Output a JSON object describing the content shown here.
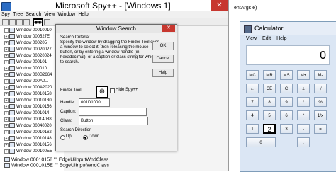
{
  "spy": {
    "title": "Microsoft Spy++ - [Windows 1]",
    "close_glyph": "✕",
    "menu": [
      "Spy",
      "Tree",
      "Search",
      "View",
      "Window",
      "Help"
    ],
    "find_icon": "binoculars-icon",
    "tree": {
      "rows": [
        "Window 00010010",
        "Window 000527E",
        "Window 000205",
        "Window 00020027",
        "Window 00020024",
        "Window 000101",
        "Window 000010",
        "Window 000B2664",
        "Window 000A0...",
        "Window 000A2020",
        "Window 00010158",
        "Window 00010130",
        "Window 00010156",
        "Window 0001014",
        "Window 00014088",
        "Window 00040020",
        "Window 00010162",
        "Window 00010148",
        "Window 00010156",
        "Window 000100EE",
        "Window 00010158",
        "Window 0001015E"
      ],
      "bottom_rows": [
        "\"\" EdgeUiInputWndClass",
        "\"\" EdgeUiInputWndClass"
      ]
    }
  },
  "dialog": {
    "title": "Window Search",
    "close_glyph": "✕",
    "criteria_label": "Search Criteria:",
    "description": "Specify the window by dragging the Finder Tool over a window to select it, then releasing the mouse button, or by entering a window handle (in hexadecimal), or a caption or class string for which to search.",
    "ok_label": "OK",
    "cancel_label": "Cancel",
    "help_label": "Help",
    "finder_label": "Finder Tool:",
    "finder_icon": "crosshair-target-icon",
    "hide_label": "Hide Spy++",
    "handle_label": "Handle:",
    "handle_value": "001D1000",
    "caption_label": "Caption:",
    "caption_value": "",
    "class_label": "Class:",
    "class_value": "Button",
    "direction_label": "Search Direction",
    "up_label": "Up",
    "down_label": "Down"
  },
  "calc": {
    "tab_text": "entArgs e)",
    "title": "Calculator",
    "menu": [
      "View",
      "Edit",
      "Help"
    ],
    "display": "0",
    "keys_top": [
      "MC",
      "MR",
      "MS",
      "M+",
      "M-"
    ],
    "keys_row2": [
      "←",
      "CE",
      "C",
      "±",
      "√"
    ],
    "keys_row3": [
      "7",
      "8",
      "9",
      "/",
      "%"
    ],
    "keys_row4": [
      "4",
      "5",
      "6",
      "*",
      "1/x"
    ],
    "keys_row5": [
      "1",
      "2",
      "3",
      "-",
      "="
    ],
    "selected_key": "2"
  }
}
